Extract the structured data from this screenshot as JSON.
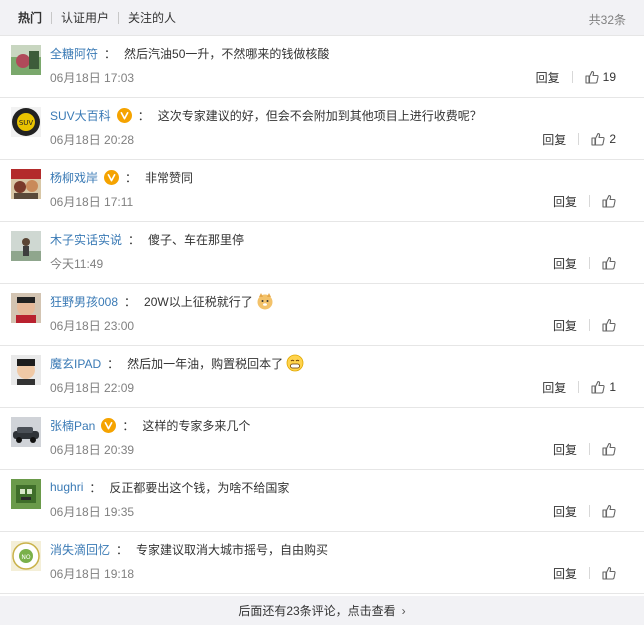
{
  "tabs": [
    {
      "label": "热门"
    },
    {
      "label": "认证用户"
    },
    {
      "label": "关注的人"
    }
  ],
  "total_label": "共32条",
  "comments": [
    {
      "user": "全糖阿符",
      "verified": false,
      "text": "然后汽油50一升，不然哪来的钱做核酸",
      "time": "06月18日 17:03",
      "likes": "19",
      "avatar": "avatar-1"
    },
    {
      "user": "SUV大百科",
      "verified": true,
      "text": "这次专家建议的好，但会不会附加到其他项目上进行收费呢？",
      "time": "06月18日 20:28",
      "likes": "2",
      "avatar": "avatar-2"
    },
    {
      "user": "杨柳戏岸",
      "verified": true,
      "text": "非常赞同",
      "time": "06月18日 17:11",
      "likes": "",
      "avatar": "avatar-3"
    },
    {
      "user": "木子实话实说",
      "verified": false,
      "text": "傻子、车在那里停",
      "time": "今天11:49",
      "likes": "",
      "avatar": "avatar-4"
    },
    {
      "user": "狂野男孩008",
      "verified": false,
      "text": "20W以上征税就行了",
      "time": "06月18日 23:00",
      "likes": "",
      "avatar": "avatar-5",
      "emoji": "doge-emoji"
    },
    {
      "user": "魔玄IPAD",
      "verified": false,
      "text": "然后加一年油，购置税回本了",
      "time": "06月18日 22:09",
      "likes": "1",
      "avatar": "avatar-6",
      "emoji": "grin-emoji"
    },
    {
      "user": "张楠Pan",
      "verified": true,
      "text": "这样的专家多来几个",
      "time": "06月18日 20:39",
      "likes": "",
      "avatar": "avatar-7"
    },
    {
      "user": "hughri",
      "verified": false,
      "text": "反正都要出这个钱，为啥不给国家",
      "time": "06月18日 19:35",
      "likes": "",
      "avatar": "avatar-8"
    },
    {
      "user": "消失滴回忆",
      "verified": false,
      "text": "专家建议取消大城市摇号，自由购买",
      "time": "06月18日 19:18",
      "likes": "",
      "avatar": "avatar-9"
    }
  ],
  "reply_label": "回复",
  "colon": "：",
  "more_label": "后面还有23条评论，点击查看",
  "colors": {
    "username": "#3a7ab5",
    "verified": "#f5a300",
    "muted": "#808080"
  }
}
